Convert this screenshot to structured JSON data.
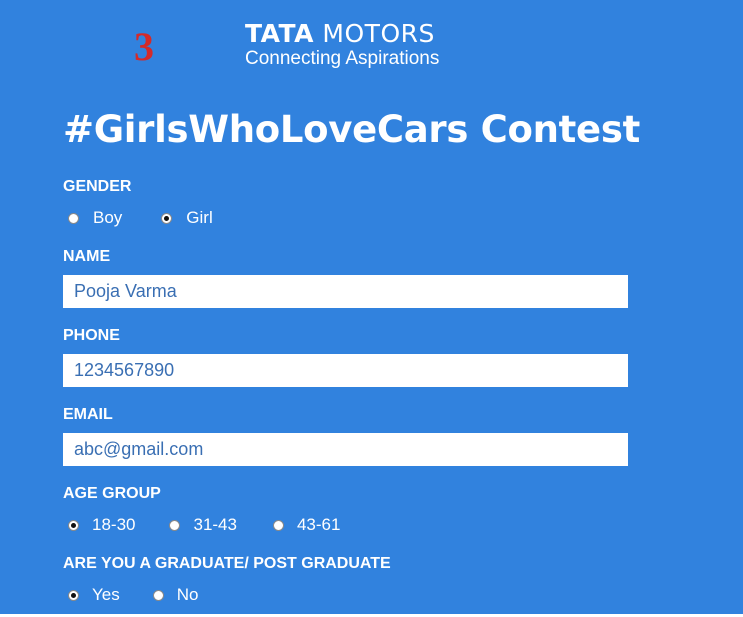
{
  "step_number": "3",
  "brand": {
    "name_bold": "TATA",
    "name_rest": " MOTORS",
    "tagline": "Connecting Aspirations"
  },
  "title": "#GirlsWhoLoveCars Contest",
  "colors": {
    "background": "#3182de",
    "step_number": "#d42a2a",
    "text": "#ffffff",
    "input_text": "#3a6fb3"
  },
  "gender": {
    "label": "GENDER",
    "options": [
      {
        "label": "Boy",
        "checked": false
      },
      {
        "label": "Girl",
        "checked": true
      }
    ]
  },
  "name": {
    "label": "NAME",
    "value": "Pooja Varma"
  },
  "phone": {
    "label": "PHONE",
    "value": "1234567890"
  },
  "email": {
    "label": "EMAIL",
    "value": "abc@gmail.com"
  },
  "age_group": {
    "label": "AGE GROUP",
    "options": [
      {
        "label": "18-30",
        "checked": true
      },
      {
        "label": "31-43",
        "checked": false
      },
      {
        "label": "43-61",
        "checked": false
      }
    ]
  },
  "graduate": {
    "label": "ARE YOU A GRADUATE/ POST GRADUATE",
    "options": [
      {
        "label": "Yes",
        "checked": true
      },
      {
        "label": "No",
        "checked": false
      }
    ]
  }
}
